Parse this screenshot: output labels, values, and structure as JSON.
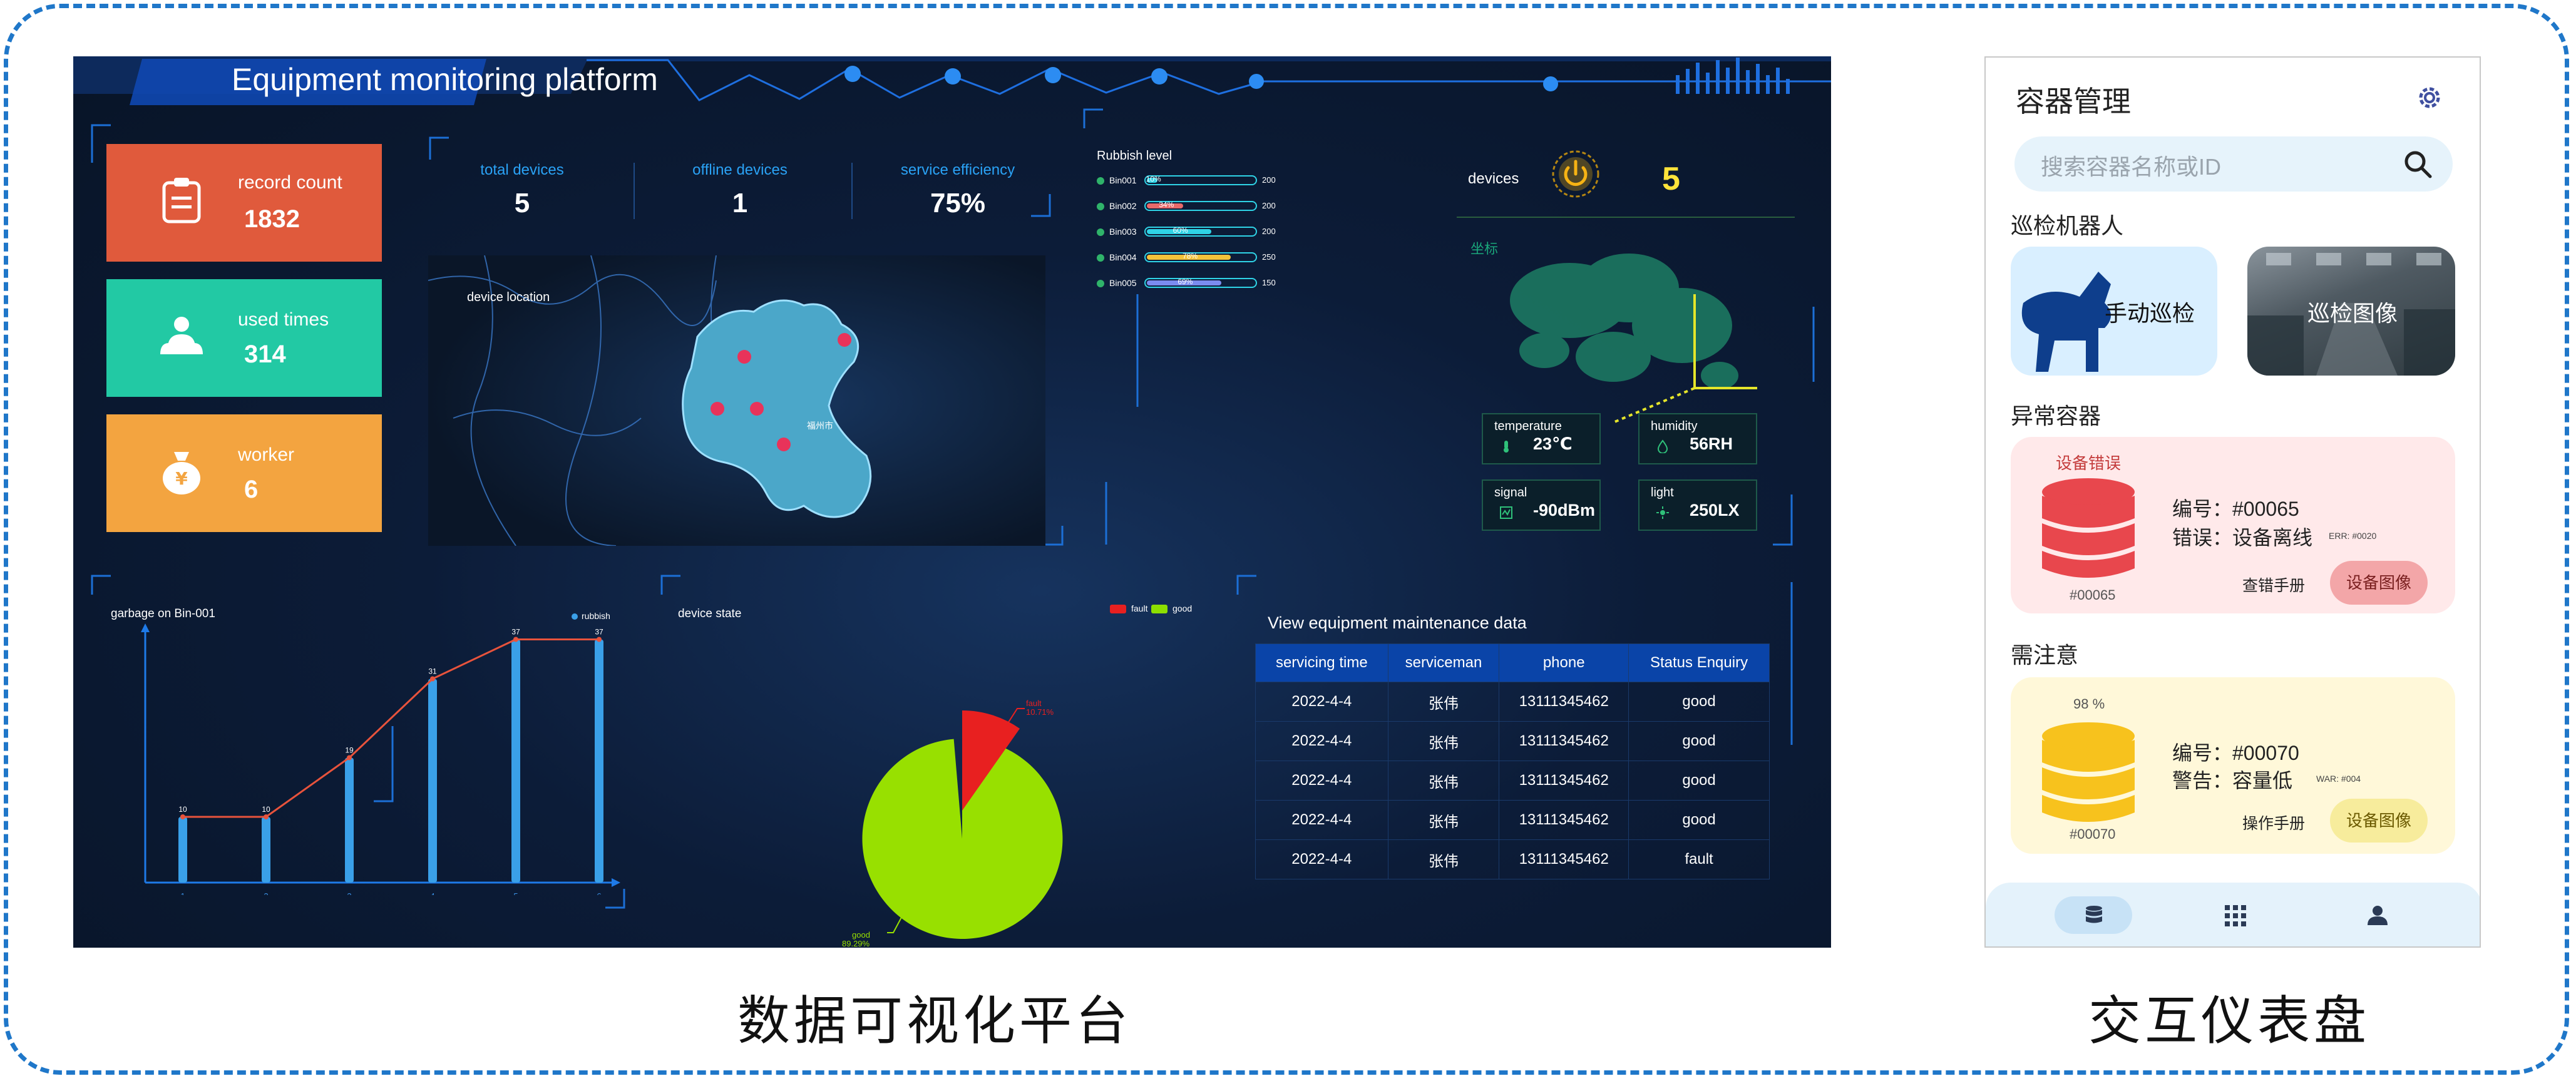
{
  "dashboard": {
    "title": "Equipment monitoring platform",
    "kpis": [
      {
        "label": "record count",
        "value": "1832",
        "color": "#e05a3c"
      },
      {
        "label": "used times",
        "value": "314",
        "color": "#22c9a4"
      },
      {
        "label": "worker",
        "value": "6",
        "color": "#f3a440"
      }
    ],
    "stats": [
      {
        "label": "total devices",
        "value": "5"
      },
      {
        "label": "offline devices",
        "value": "1"
      },
      {
        "label": "service efficiency",
        "value": "75%"
      }
    ],
    "map": {
      "label": "device location",
      "city": "福州市"
    },
    "rubbish": {
      "title": "Rubbish level",
      "bins": [
        {
          "name": "Bin001",
          "pct": "10%",
          "level": 0.1,
          "cap": "200",
          "color": "#2fd3e6"
        },
        {
          "name": "Bin002",
          "pct": "34%",
          "level": 0.34,
          "cap": "200",
          "color": "#e86a6a"
        },
        {
          "name": "Bin003",
          "pct": "60%",
          "level": 0.6,
          "cap": "200",
          "color": "#2fd3e6"
        },
        {
          "name": "Bin004",
          "pct": "78%",
          "level": 0.78,
          "cap": "250",
          "color": "#f3c33a"
        },
        {
          "name": "Bin005",
          "pct": "69%",
          "level": 0.69,
          "cap": "150",
          "color": "#7b8cf0"
        }
      ]
    },
    "devices": {
      "label": "devices",
      "value": "5",
      "coord_label": "坐标"
    },
    "sensors": [
      {
        "label": "temperature",
        "value": "23℃",
        "icon": "thermometer-icon"
      },
      {
        "label": "humidity",
        "value": "56RH",
        "icon": "droplet-icon"
      },
      {
        "label": "signal",
        "value": "-90dBm",
        "icon": "signal-icon"
      },
      {
        "label": "light",
        "value": "250LX",
        "icon": "sun-icon"
      }
    ],
    "device_state": {
      "title": "device state",
      "legend_fault": "fault",
      "legend_good": "good",
      "fault_label": "fault",
      "fault_pct": "10.71%",
      "good_label": "good",
      "good_pct": "89.29%"
    },
    "maintenance": {
      "title": "View equipment maintenance data",
      "headers": [
        "servicing time",
        "serviceman",
        "phone",
        "Status Enquiry"
      ],
      "rows": [
        [
          "2022-4-4",
          "张伟",
          "13111345462",
          "good"
        ],
        [
          "2022-4-4",
          "张伟",
          "13111345462",
          "good"
        ],
        [
          "2022-4-4",
          "张伟",
          "13111345462",
          "good"
        ],
        [
          "2022-4-4",
          "张伟",
          "13111345462",
          "good"
        ],
        [
          "2022-4-4",
          "张伟",
          "13111345462",
          "fault"
        ]
      ]
    }
  },
  "chart_data": {
    "type": "bar",
    "title": "garbage on Bin-001",
    "legend": "rubbish",
    "categories": [
      "1",
      "2",
      "3",
      "4",
      "5",
      "6"
    ],
    "values": [
      10,
      10,
      19,
      31,
      37,
      37
    ],
    "ylim": [
      0,
      40
    ],
    "line_overlay": true,
    "bar_color": "#3aa0e8",
    "line_color": "#e8533c"
  },
  "captions": {
    "left": "数据可视化平台",
    "right": "交互仪表盘"
  },
  "phone": {
    "title": "容器管理",
    "search_placeholder": "搜索容器名称或ID",
    "robot_section": "巡检机器人",
    "manual_patrol": "手动巡检",
    "patrol_image": "巡检图像",
    "abnormal_section": "异常容器",
    "abnormal": {
      "tag": "设备错误",
      "id_line": "编号：#00065",
      "err_line": "错误：设备离线",
      "err_code": "ERR: #0020",
      "id": "#00065",
      "btn_manual": "查错手册",
      "btn_image": "设备图像"
    },
    "attention_section": "需注意",
    "attention": {
      "pct": "98 %",
      "id_line": "编号：#00070",
      "warn_line": "警告：容量低",
      "warn_code": "WAR: #004",
      "id": "#00070",
      "btn_manual": "操作手册",
      "btn_image": "设备图像"
    }
  }
}
